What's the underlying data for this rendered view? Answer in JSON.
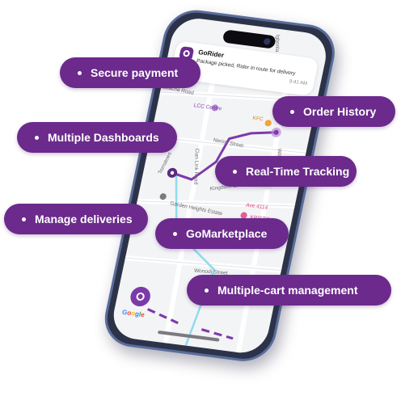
{
  "notification": {
    "app_name": "GoRider",
    "message": "Package picked, Rider in route for delivery",
    "time": "9:41 AM"
  },
  "map": {
    "labels": {
      "road_top": "Igbonla",
      "road_left": "abacha Road",
      "lcc_centre": "LCC Centre",
      "kfc": "KFC",
      "nerimi": "Nerimi Street",
      "wolf": "Wolf R",
      "clan_link": "Clan Link Road",
      "kingdom": "Kingdom Cr",
      "tomatoes": "Tomatoes",
      "garden_heights": "Garden Heights Estate",
      "address": "Ave 4114",
      "kristov": "KRISTOV",
      "wonodi": "Wonodi Street"
    },
    "route_color": "#7c3aa9",
    "google_letters": [
      "G",
      "o",
      "o",
      "g",
      "l",
      "e"
    ]
  },
  "features": [
    {
      "label": "Secure payment"
    },
    {
      "label": "Order History"
    },
    {
      "label": "Multiple Dashboards"
    },
    {
      "label": "Real-Time Tracking"
    },
    {
      "label": "Manage deliveries"
    },
    {
      "label": "GoMarketplace"
    },
    {
      "label": "Multiple-cart management"
    }
  ],
  "colors": {
    "pill_bg": "#6b2a8c",
    "pill_text": "#ffffff",
    "phone_frame": "#2c3349",
    "brand_purple": "#7c3aa9"
  }
}
